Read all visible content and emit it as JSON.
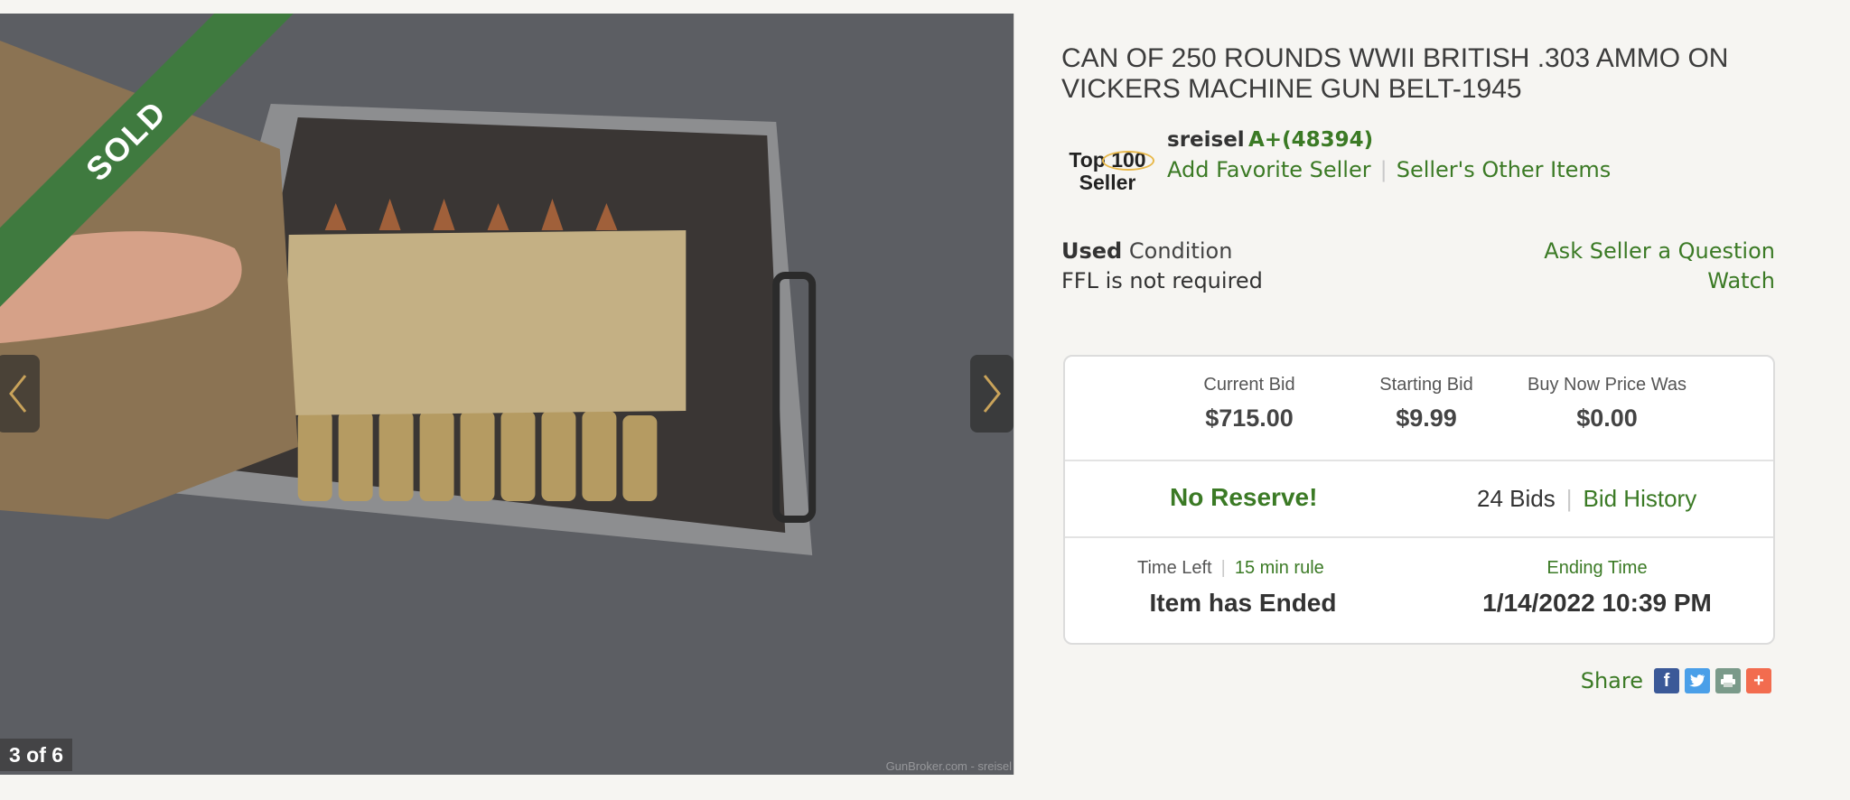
{
  "gallery": {
    "sold_label": "SOLD",
    "counter": "3 of 6",
    "watermark": "GunBroker.com - sreisel",
    "prev_icon": "chevron-left-icon",
    "next_icon": "chevron-right-icon"
  },
  "listing": {
    "title": "CAN OF 250 ROUNDS WWII BRITISH .303 AMMO ON VICKERS MACHINE GUN BELT-1945",
    "condition_label": "Used",
    "condition_suffix": "Condition",
    "ffl": "FFL is not required",
    "ask_seller": "Ask Seller a Question",
    "watch": "Watch"
  },
  "seller": {
    "badge_line1": "Top 100",
    "badge_line2": "Seller",
    "name": "sreisel",
    "rating": "A+(48394)",
    "add_favorite": "Add Favorite Seller",
    "other_items": "Seller's Other Items"
  },
  "bidding": {
    "current_bid_label": "Current Bid",
    "current_bid": "$715.00",
    "starting_bid_label": "Starting Bid",
    "starting_bid": "$9.99",
    "buy_now_label": "Buy Now Price Was",
    "buy_now": "$0.00",
    "reserve": "No Reserve!",
    "bids": "24 Bids",
    "bid_history": "Bid History",
    "time_left_label": "Time Left",
    "rule": "15 min rule",
    "time_left": "Item has Ended",
    "ending_time_label": "Ending Time",
    "ending_time": "1/14/2022 10:39 PM"
  },
  "share": {
    "label": "Share",
    "icons": [
      "facebook-icon",
      "twitter-icon",
      "print-icon",
      "more-icon"
    ]
  },
  "colors": {
    "accent_green": "#3b7a25",
    "sold_banner": "#3f7a3f"
  }
}
